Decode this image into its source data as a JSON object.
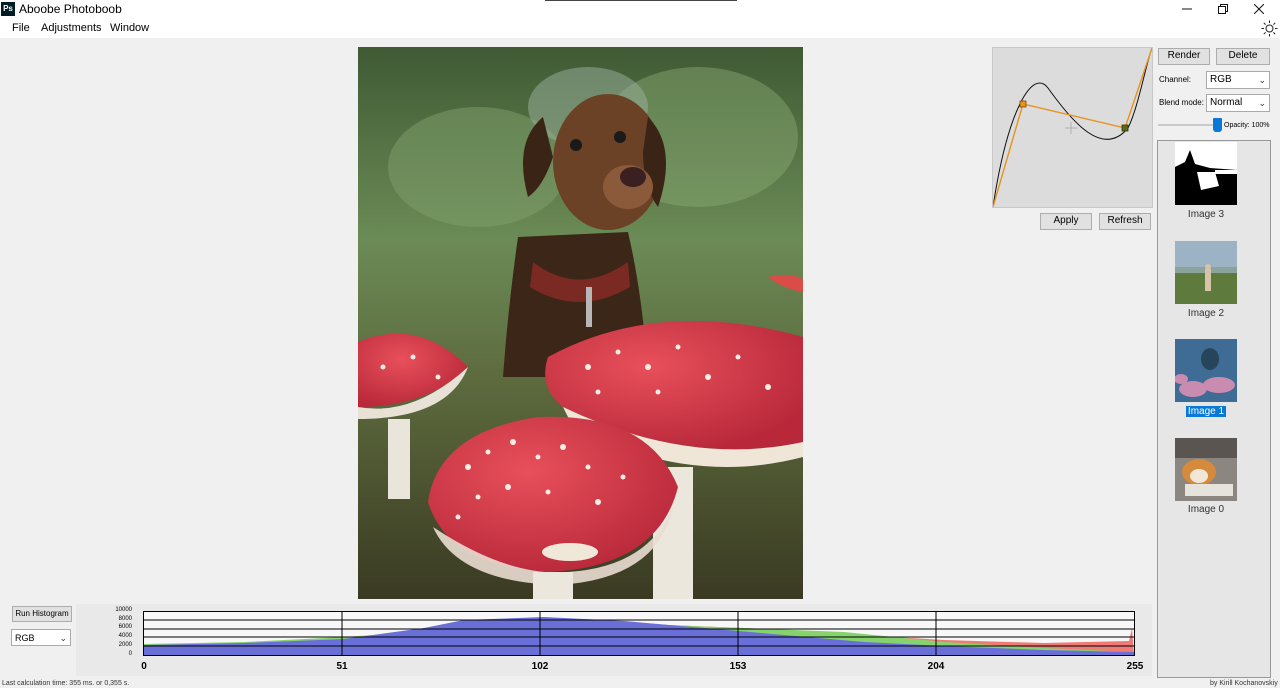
{
  "app": {
    "title": "Aboobe Photoboob",
    "icon_text": "Ps"
  },
  "window_controls": {
    "minimize": "–",
    "maximize": "❐",
    "close": "✕"
  },
  "menu": {
    "items": [
      "File",
      "Adjustments",
      "Window"
    ]
  },
  "curves": {
    "apply_label": "Apply",
    "refresh_label": "Refresh"
  },
  "toolbar": {
    "render_label": "Render",
    "delete_label": "Delete"
  },
  "channel": {
    "label": "Channel:",
    "value": "RGB"
  },
  "blend": {
    "label": "Blend mode:",
    "value": "Normal"
  },
  "opacity": {
    "label": "Opacity: 100%",
    "value": 1.0
  },
  "layers": [
    {
      "label": "Image 3",
      "selected": false
    },
    {
      "label": "Image 2",
      "selected": false
    },
    {
      "label": "Image 1",
      "selected": true
    },
    {
      "label": "Image 0",
      "selected": false
    }
  ],
  "histogram": {
    "button_label": "Run Histogram",
    "channel_value": "RGB",
    "y_ticks": [
      "10000",
      "8000",
      "6000",
      "4000",
      "2000",
      "0"
    ],
    "x_ticks": [
      "0",
      "51",
      "102",
      "153",
      "204",
      "255"
    ],
    "colors": {
      "red": "#f07a74",
      "green": "#86d36e",
      "blue": "#6a6fd8"
    }
  },
  "status": {
    "calc_time": "Last calculation time: 355 ms. or 0,355 s.",
    "author": "by Kirill Kochanovskiy"
  }
}
